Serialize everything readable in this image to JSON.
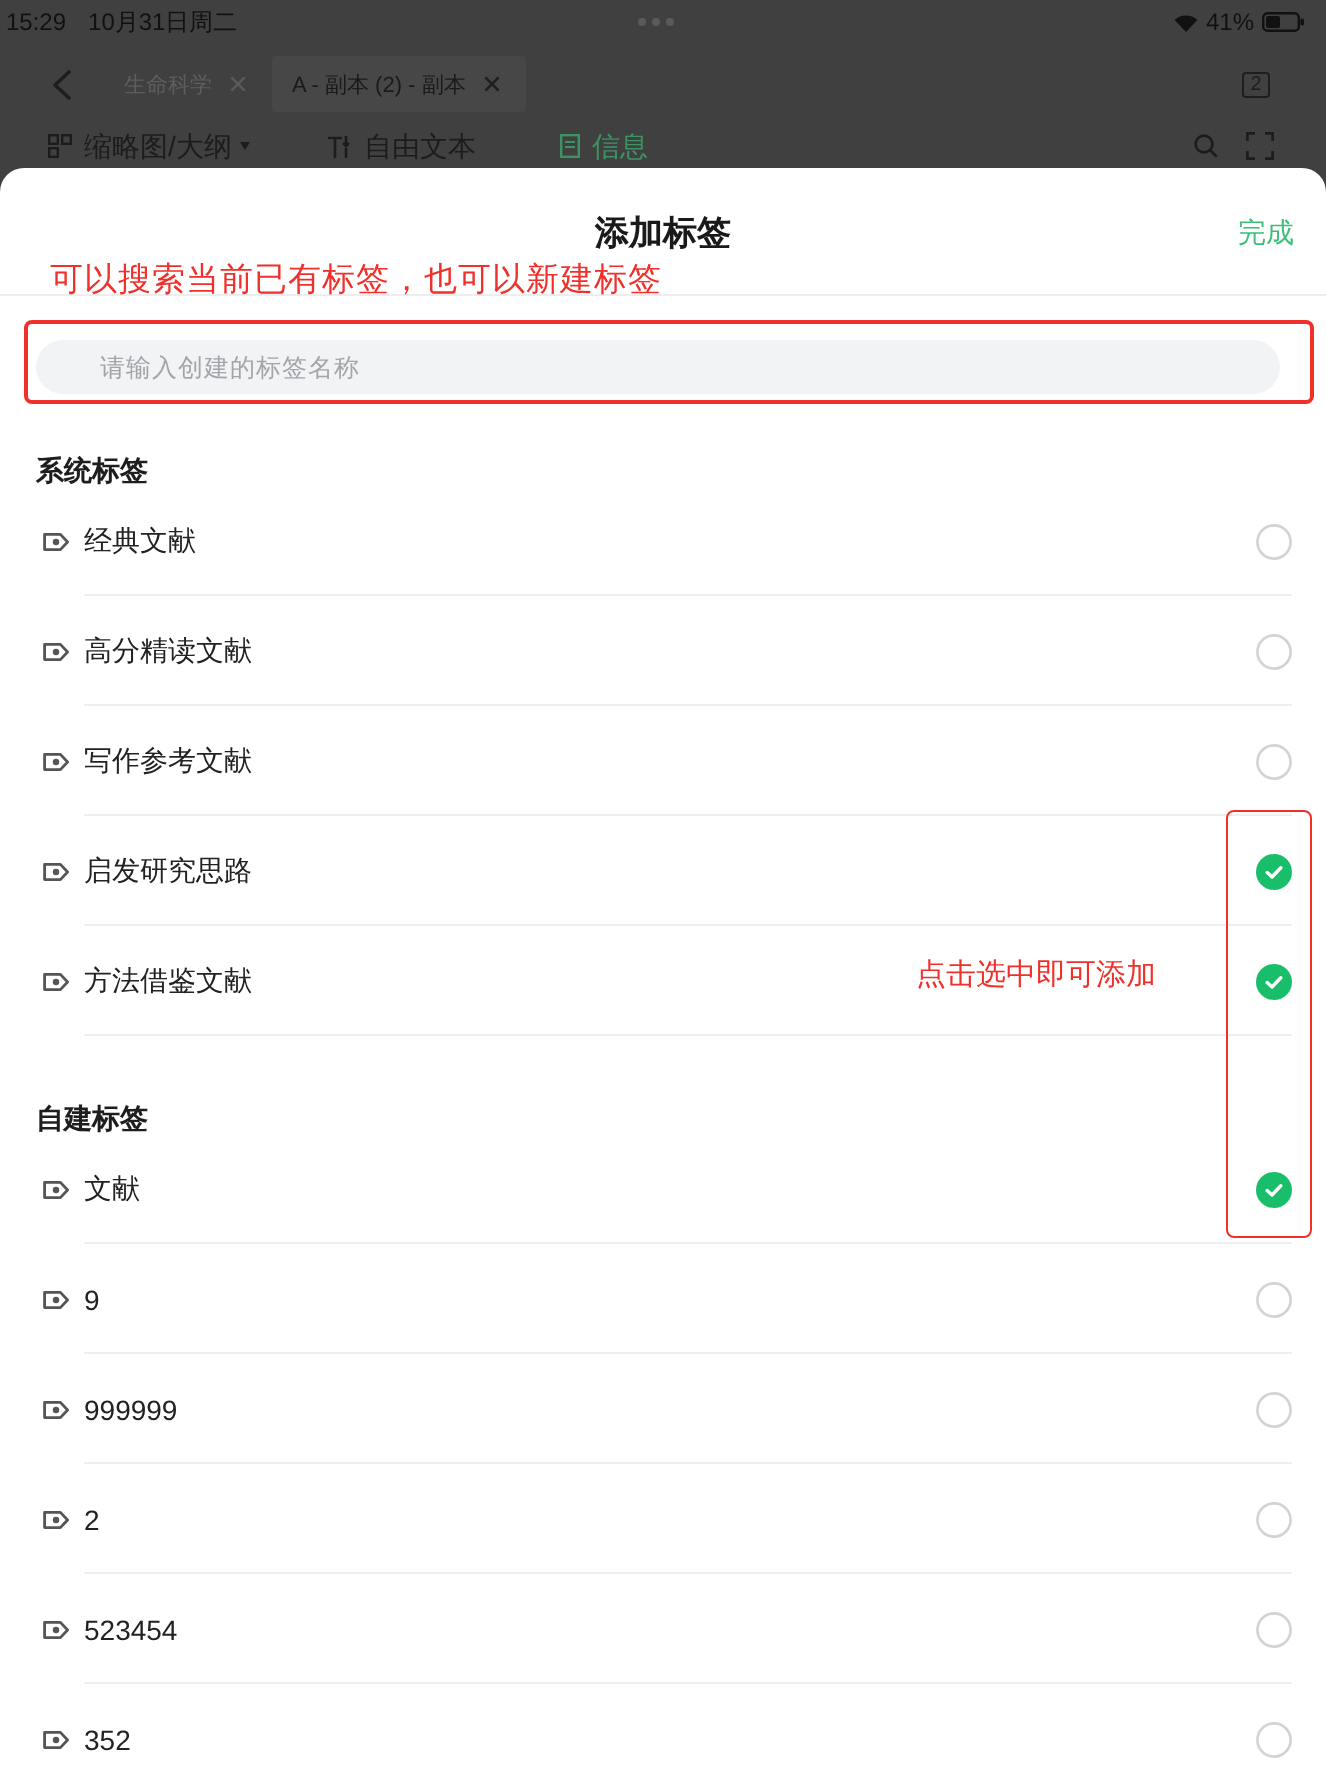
{
  "status_bar": {
    "time": "15:29",
    "date": "10月31日周二",
    "battery": "41%"
  },
  "tabs_bar": {
    "tabs": [
      {
        "label": "生命科学",
        "selected": false
      },
      {
        "label": "A - 副本 (2) - 副本",
        "selected": true
      }
    ],
    "tab_count": "2"
  },
  "toolbar": {
    "items": [
      {
        "label": "缩略图/大纲",
        "kind": "dropdown",
        "selected": false
      },
      {
        "label": "自由文本",
        "kind": "button",
        "selected": false
      },
      {
        "label": "信息",
        "kind": "button",
        "selected": true
      }
    ]
  },
  "sheet": {
    "title": "添加标签",
    "done_button": "完成",
    "search": {
      "placeholder": "请输入创建的标签名称"
    },
    "sections": [
      {
        "title": "系统标签",
        "tags": [
          {
            "name": "经典文献",
            "checked": false
          },
          {
            "name": "高分精读文献",
            "checked": false
          },
          {
            "name": "写作参考文献",
            "checked": false
          },
          {
            "name": "启发研究思路",
            "checked": true
          },
          {
            "name": "方法借鉴文献",
            "checked": true
          }
        ]
      },
      {
        "title": "自建标签",
        "tags": [
          {
            "name": "文献",
            "checked": true
          },
          {
            "name": "9",
            "checked": false
          },
          {
            "name": "999999",
            "checked": false
          },
          {
            "name": "2",
            "checked": false
          },
          {
            "name": "523454",
            "checked": false
          },
          {
            "name": "352",
            "checked": false
          }
        ]
      }
    ]
  },
  "annotations": [
    {
      "kind": "search-box",
      "text": "可以搜索当前已有标签，也可以新建标签"
    },
    {
      "kind": "check-column",
      "text": "点击选中即可添加"
    }
  ]
}
